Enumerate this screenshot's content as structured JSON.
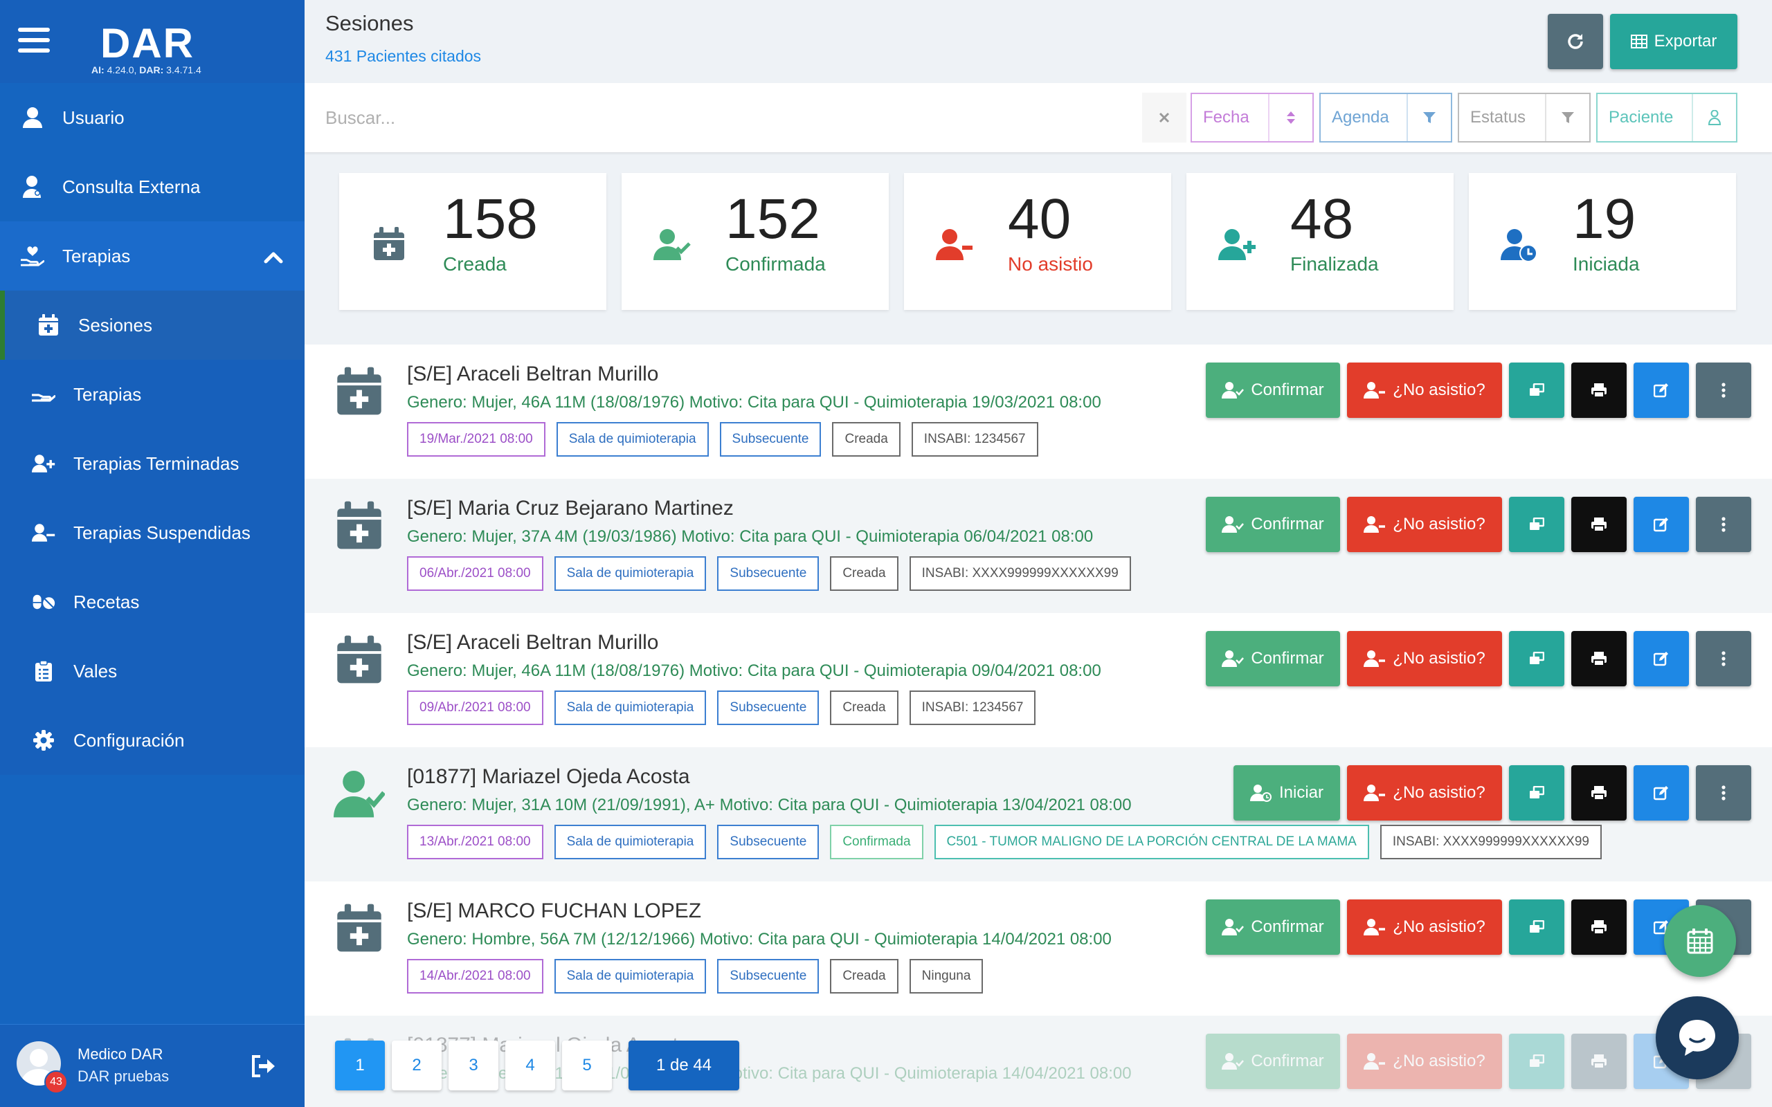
{
  "sidebar": {
    "logo": "DAR",
    "version_ai_label": "AI:",
    "version_ai": "4.24.0,",
    "version_dar_label": "DAR:",
    "version_dar": "3.4.71.4",
    "items": [
      {
        "label": "Usuario",
        "icon": "user-icon"
      },
      {
        "label": "Consulta Externa",
        "icon": "user-clinic-icon"
      },
      {
        "label": "Terapias",
        "icon": "hand-heart-icon"
      },
      {
        "label": "Sesiones",
        "icon": "calendar-plus-icon"
      },
      {
        "label": "Terapias",
        "icon": "hand-icon"
      },
      {
        "label": "Terapias Terminadas",
        "icon": "user-plus-icon"
      },
      {
        "label": "Terapias Suspendidas",
        "icon": "user-minus-icon"
      },
      {
        "label": "Recetas",
        "icon": "pills-icon"
      },
      {
        "label": "Vales",
        "icon": "clipboard-icon"
      },
      {
        "label": "Configuración",
        "icon": "gear-icon"
      }
    ],
    "user": {
      "name": "Medico DAR",
      "role": "DAR pruebas",
      "badge": "43"
    }
  },
  "header": {
    "title": "Sesiones",
    "subtitle": "431 Pacientes citados",
    "export_label": "Exportar"
  },
  "search": {
    "placeholder": "Buscar...",
    "filters": {
      "fecha": "Fecha",
      "agenda": "Agenda",
      "estatus": "Estatus",
      "paciente": "Paciente"
    }
  },
  "stats": [
    {
      "value": "158",
      "label": "Creada",
      "color": "#2e8b57"
    },
    {
      "value": "152",
      "label": "Confirmada",
      "color": "#2e8b57"
    },
    {
      "value": "40",
      "label": "No asistio",
      "color": "#e23d2b"
    },
    {
      "value": "48",
      "label": "Finalizada",
      "color": "#2e8b57"
    },
    {
      "value": "19",
      "label": "Iniciada",
      "color": "#2e8b57"
    }
  ],
  "sessions": [
    {
      "title": "[S/E] Araceli Beltran Murillo",
      "subtitle": "Genero: Mujer, 46A 11M (18/08/1976) Motivo: Cita para QUI - Quimioterapia 19/03/2021 08:00",
      "date_tag": "19/Mar./2021 08:00",
      "sala": "Sala de quimioterapia",
      "tipo": "Subsecuente",
      "estado": "Creada",
      "insabi": "INSABI: 1234567",
      "primary": "Confirmar"
    },
    {
      "title": "[S/E] Maria Cruz Bejarano Martinez",
      "subtitle": "Genero: Mujer, 37A 4M (19/03/1986) Motivo: Cita para QUI - Quimioterapia 06/04/2021 08:00",
      "date_tag": "06/Abr./2021 08:00",
      "sala": "Sala de quimioterapia",
      "tipo": "Subsecuente",
      "estado": "Creada",
      "insabi": "INSABI: XXXX999999XXXXXX99",
      "primary": "Confirmar"
    },
    {
      "title": "[S/E] Araceli Beltran Murillo",
      "subtitle": "Genero: Mujer, 46A 11M (18/08/1976) Motivo: Cita para QUI - Quimioterapia 09/04/2021 08:00",
      "date_tag": "09/Abr./2021 08:00",
      "sala": "Sala de quimioterapia",
      "tipo": "Subsecuente",
      "estado": "Creada",
      "insabi": "INSABI: 1234567",
      "primary": "Confirmar"
    },
    {
      "title": "[01877] Mariazel Ojeda Acosta",
      "subtitle": "Genero: Mujer, 31A 10M (21/09/1991), A+ Motivo: Cita para QUI - Quimioterapia 13/04/2021 08:00",
      "date_tag": "13/Abr./2021 08:00",
      "sala": "Sala de quimioterapia",
      "tipo": "Subsecuente",
      "estado": "Confirmada",
      "diagnostico": "C501 - TUMOR MALIGNO DE LA PORCIÓN CENTRAL DE LA MAMA",
      "insabi": "INSABI: XXXX999999XXXXXX99",
      "primary": "Iniciar"
    },
    {
      "title": "[S/E] MARCO FUCHAN LOPEZ",
      "subtitle": "Genero: Hombre, 56A 7M (12/12/1966) Motivo: Cita para QUI - Quimioterapia 14/04/2021 08:00",
      "date_tag": "14/Abr./2021 08:00",
      "sala": "Sala de quimioterapia",
      "tipo": "Subsecuente",
      "estado": "Creada",
      "insabi": "Ninguna",
      "primary": "Confirmar"
    },
    {
      "title": "[01877] Mariazel Ojeda Acosta",
      "subtitle": "Genero: Mujer, 31A 10M (21/09/1991), A+ Motivo: Cita para QUI - Quimioterapia 14/04/2021 08:00",
      "primary": "Confirmar"
    }
  ],
  "no_asistio_label": "¿No asistio?",
  "pagination": {
    "pages": [
      "1",
      "2",
      "3",
      "4",
      "5"
    ],
    "total": "1 de 44"
  }
}
